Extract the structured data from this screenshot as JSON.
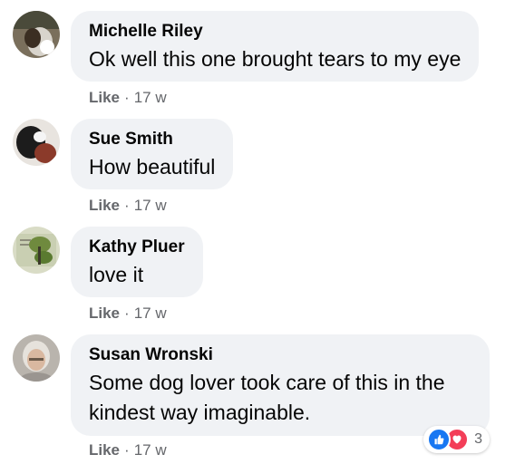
{
  "comments": [
    {
      "author": "Michelle Riley",
      "text": "Ok well this one brought tears to my eye",
      "like_label": "Like",
      "separator": "·",
      "age": "17 w"
    },
    {
      "author": "Sue Smith",
      "text": "How beautiful",
      "like_label": "Like",
      "separator": "·",
      "age": "17 w"
    },
    {
      "author": "Kathy Pluer",
      "text": "love it",
      "like_label": "Like",
      "separator": "·",
      "age": "17 w"
    },
    {
      "author": "Susan Wronski",
      "text": "Some dog lover took care of this in the kindest way imaginable.",
      "like_label": "Like",
      "separator": "·",
      "age": "17 w",
      "reactions": {
        "icons": [
          "like-icon",
          "heart-icon"
        ],
        "count": "3"
      }
    }
  ],
  "colors": {
    "bubble": "#f0f2f5",
    "secondary_text": "#65676b",
    "like_blue": "#1877f2",
    "love_red": "#f33e58"
  }
}
